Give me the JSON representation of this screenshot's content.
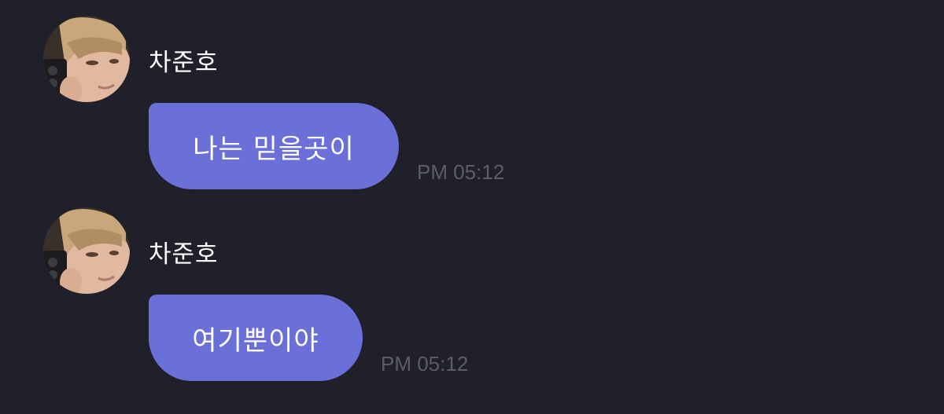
{
  "messages": [
    {
      "sender": "차준호",
      "text": "나는 믿을곳이",
      "time": "PM 05:12"
    },
    {
      "sender": "차준호",
      "text": "여기뿐이야",
      "time": "PM 05:12"
    }
  ],
  "colors": {
    "background": "#20202b",
    "bubble": "#6b6fd8",
    "sender_text": "#ffffff",
    "time_text": "#5c5d6b"
  }
}
